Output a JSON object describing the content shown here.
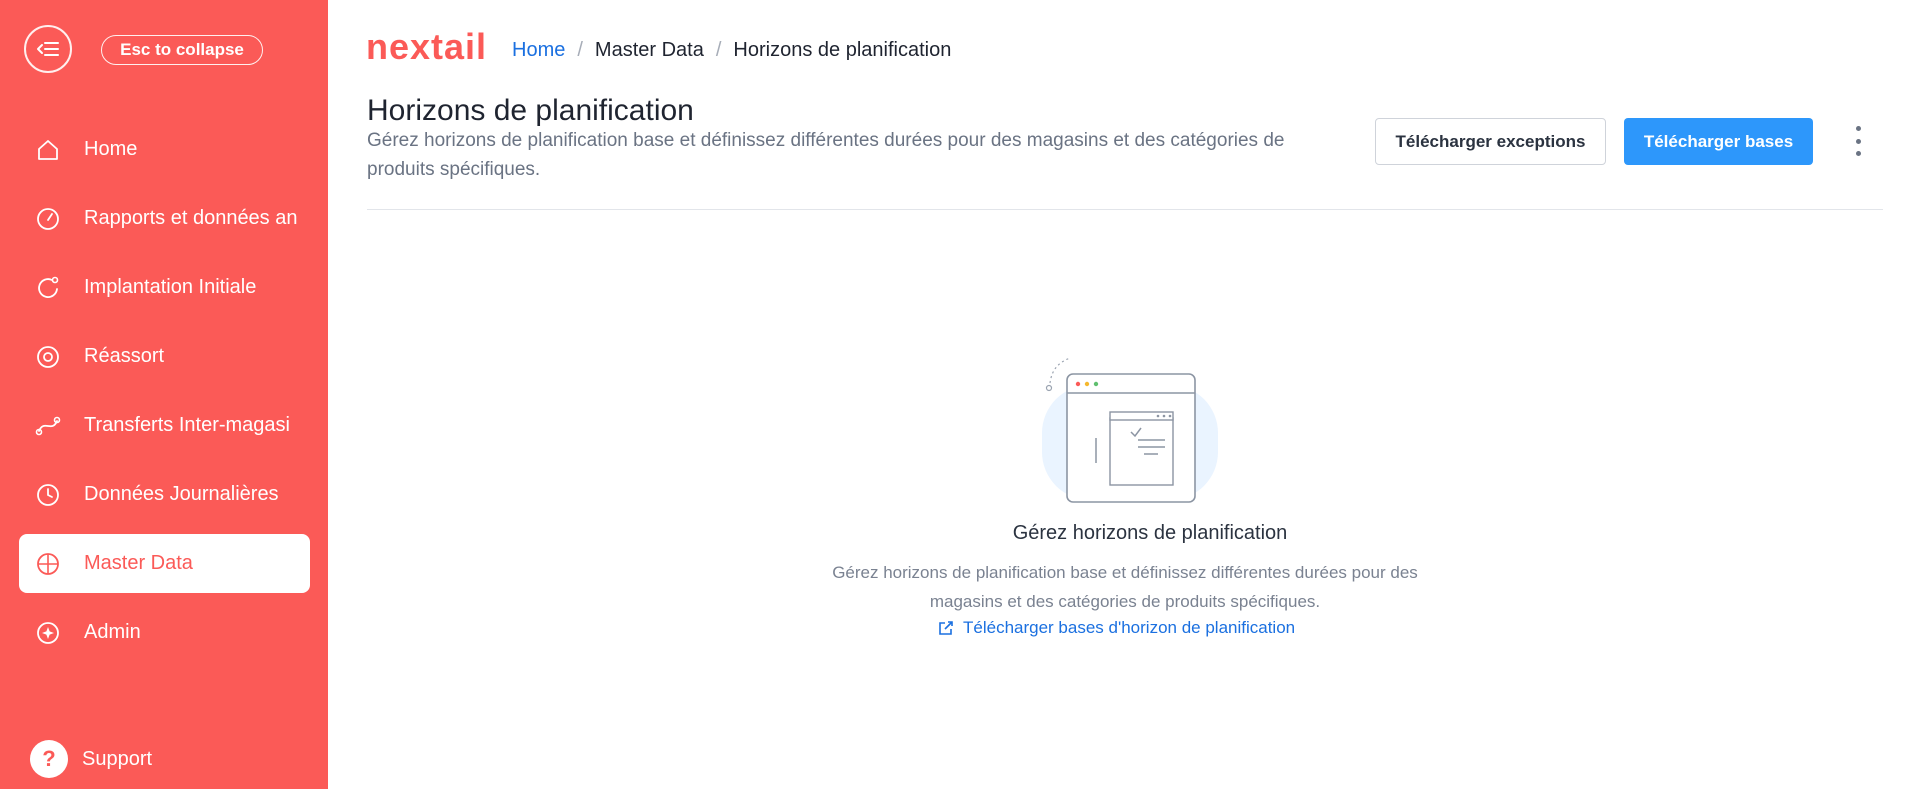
{
  "sidebar": {
    "collapse_hint": "Esc to collapse",
    "items": [
      {
        "label": "Home",
        "icon": "home-icon",
        "active": false
      },
      {
        "label": "Rapports et données an",
        "icon": "gauge-icon",
        "active": false
      },
      {
        "label": "Implantation Initiale",
        "icon": "cycle-icon",
        "active": false
      },
      {
        "label": "Réassort",
        "icon": "target-icon",
        "active": false
      },
      {
        "label": "Transferts Inter-magasi",
        "icon": "transfer-icon",
        "active": false
      },
      {
        "label": "Données Journalières",
        "icon": "clock-icon",
        "active": false
      },
      {
        "label": "Master Data",
        "icon": "globe-icon",
        "active": true
      },
      {
        "label": "Admin",
        "icon": "admin-icon",
        "active": false
      }
    ],
    "support_label": "Support"
  },
  "header": {
    "brand": "nextail",
    "breadcrumb": [
      "Home",
      "Master Data",
      "Horizons de planification"
    ]
  },
  "page": {
    "title": "Horizons de planification",
    "description": "Gérez horizons de planification base et définissez différentes durées pour des magasins et des catégories de produits spécifiques.",
    "btn_exceptions": "Télécharger exceptions",
    "btn_bases": "Télécharger bases"
  },
  "empty_state": {
    "title": "Gérez horizons de planification",
    "description": "Gérez horizons de planification base et définissez différentes durées pour des magasins et des catégories de produits spécifiques.",
    "link": "Télécharger bases d'horizon de planification"
  },
  "colors": {
    "brand": "#fb5a57",
    "primary": "#2d97fb",
    "link": "#1b70e0"
  }
}
